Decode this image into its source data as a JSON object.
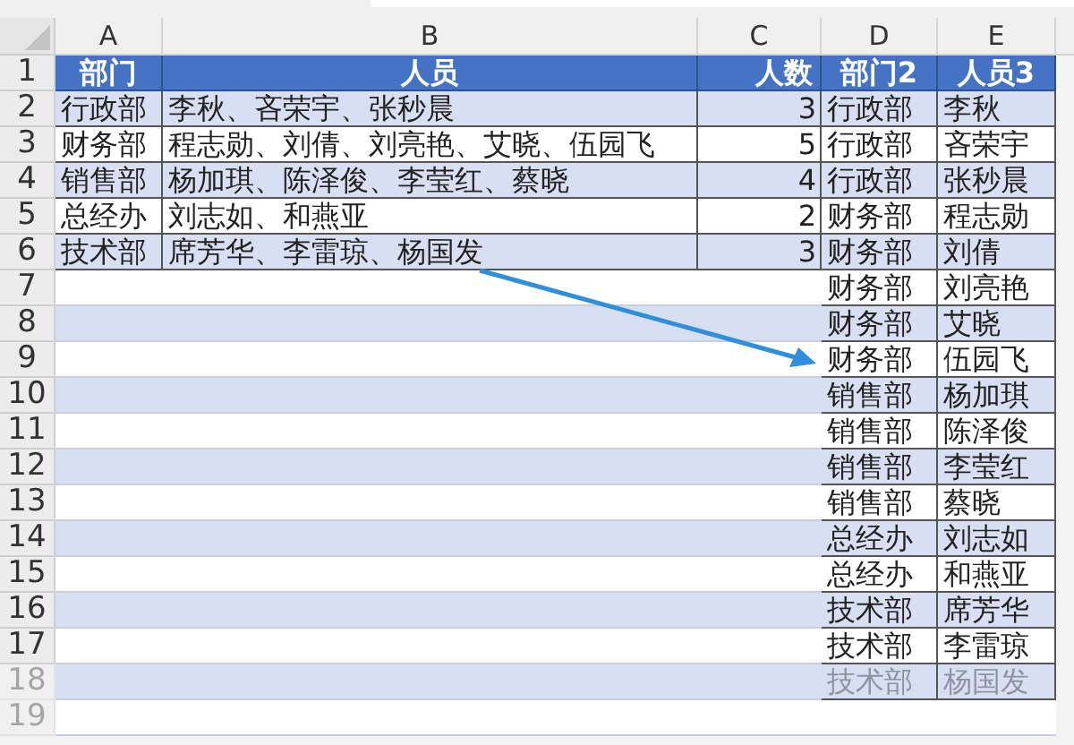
{
  "columns": [
    "A",
    "B",
    "C",
    "D",
    "E"
  ],
  "rows": [
    {
      "number": "1",
      "kind": "header",
      "faded": false,
      "a": "部门",
      "b": "人员",
      "c": "人数",
      "d": "部门2",
      "e": "人员3"
    },
    {
      "number": "2",
      "kind": "data",
      "faded": false,
      "a": "行政部",
      "b": "李秋、吝荣宇、张秒晨",
      "c": "3",
      "d": "行政部",
      "e": "李秋"
    },
    {
      "number": "3",
      "kind": "data",
      "faded": false,
      "a": "财务部",
      "b": "程志勋、刘倩、刘亮艳、艾晓、伍园飞",
      "c": "5",
      "d": "行政部",
      "e": "吝荣宇"
    },
    {
      "number": "4",
      "kind": "data",
      "faded": false,
      "a": "销售部",
      "b": "杨加琪、陈泽俊、李莹红、蔡晓",
      "c": "4",
      "d": "行政部",
      "e": "张秒晨"
    },
    {
      "number": "5",
      "kind": "data",
      "faded": false,
      "a": "总经办",
      "b": "刘志如、和燕亚",
      "c": "2",
      "d": "财务部",
      "e": "程志勋"
    },
    {
      "number": "6",
      "kind": "data",
      "faded": false,
      "a": "技术部",
      "b": "席芳华、李雷琼、杨国发",
      "c": "3",
      "d": "财务部",
      "e": "刘倩"
    },
    {
      "number": "7",
      "kind": "data",
      "faded": false,
      "d": "财务部",
      "e": "刘亮艳"
    },
    {
      "number": "8",
      "kind": "data",
      "faded": false,
      "d": "财务部",
      "e": "艾晓"
    },
    {
      "number": "9",
      "kind": "data",
      "faded": false,
      "d": "财务部",
      "e": "伍园飞"
    },
    {
      "number": "10",
      "kind": "data",
      "faded": false,
      "d": "销售部",
      "e": "杨加琪"
    },
    {
      "number": "11",
      "kind": "data",
      "faded": false,
      "d": "销售部",
      "e": "陈泽俊"
    },
    {
      "number": "12",
      "kind": "data",
      "faded": false,
      "d": "销售部",
      "e": "李莹红"
    },
    {
      "number": "13",
      "kind": "data",
      "faded": false,
      "d": "销售部",
      "e": "蔡晓"
    },
    {
      "number": "14",
      "kind": "data",
      "faded": false,
      "d": "总经办",
      "e": "刘志如"
    },
    {
      "number": "15",
      "kind": "data",
      "faded": false,
      "d": "总经办",
      "e": "和燕亚"
    },
    {
      "number": "16",
      "kind": "data",
      "faded": false,
      "d": "技术部",
      "e": "席芳华"
    },
    {
      "number": "17",
      "kind": "data",
      "faded": false,
      "d": "技术部",
      "e": "李雷琼"
    },
    {
      "number": "18",
      "kind": "data",
      "faded": true,
      "d": "技术部",
      "e": "杨国发"
    },
    {
      "number": "19",
      "kind": "data",
      "faded": true
    }
  ]
}
